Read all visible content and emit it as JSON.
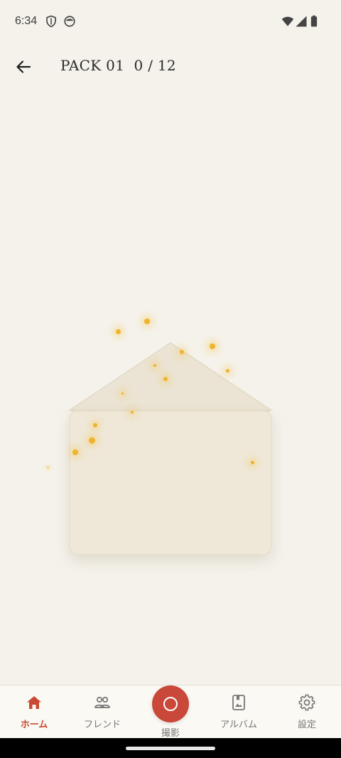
{
  "status_bar": {
    "time": "6:34",
    "left_icons": [
      "shield-icon",
      "app-face-icon"
    ],
    "right_icons": [
      "wifi-icon",
      "cell-signal-icon",
      "battery-icon"
    ]
  },
  "header": {
    "back_icon": "arrow-left-icon",
    "title": "PACK 01  0 / 12"
  },
  "colors": {
    "background": "#f5f2eb",
    "accent": "#c9483a",
    "envelope_fill": "#efe8da",
    "sparkle": "#f0b42c"
  },
  "bottom_nav": {
    "items": [
      {
        "label": "ホーム",
        "icon": "home-icon",
        "active": true
      },
      {
        "label": "フレンド",
        "icon": "friends-icon",
        "active": false
      },
      {
        "label": "撮影",
        "icon": "camera-shutter-icon",
        "active": false
      },
      {
        "label": "アルバム",
        "icon": "album-icon",
        "active": false
      },
      {
        "label": "設定",
        "icon": "gear-icon",
        "active": false
      }
    ]
  }
}
